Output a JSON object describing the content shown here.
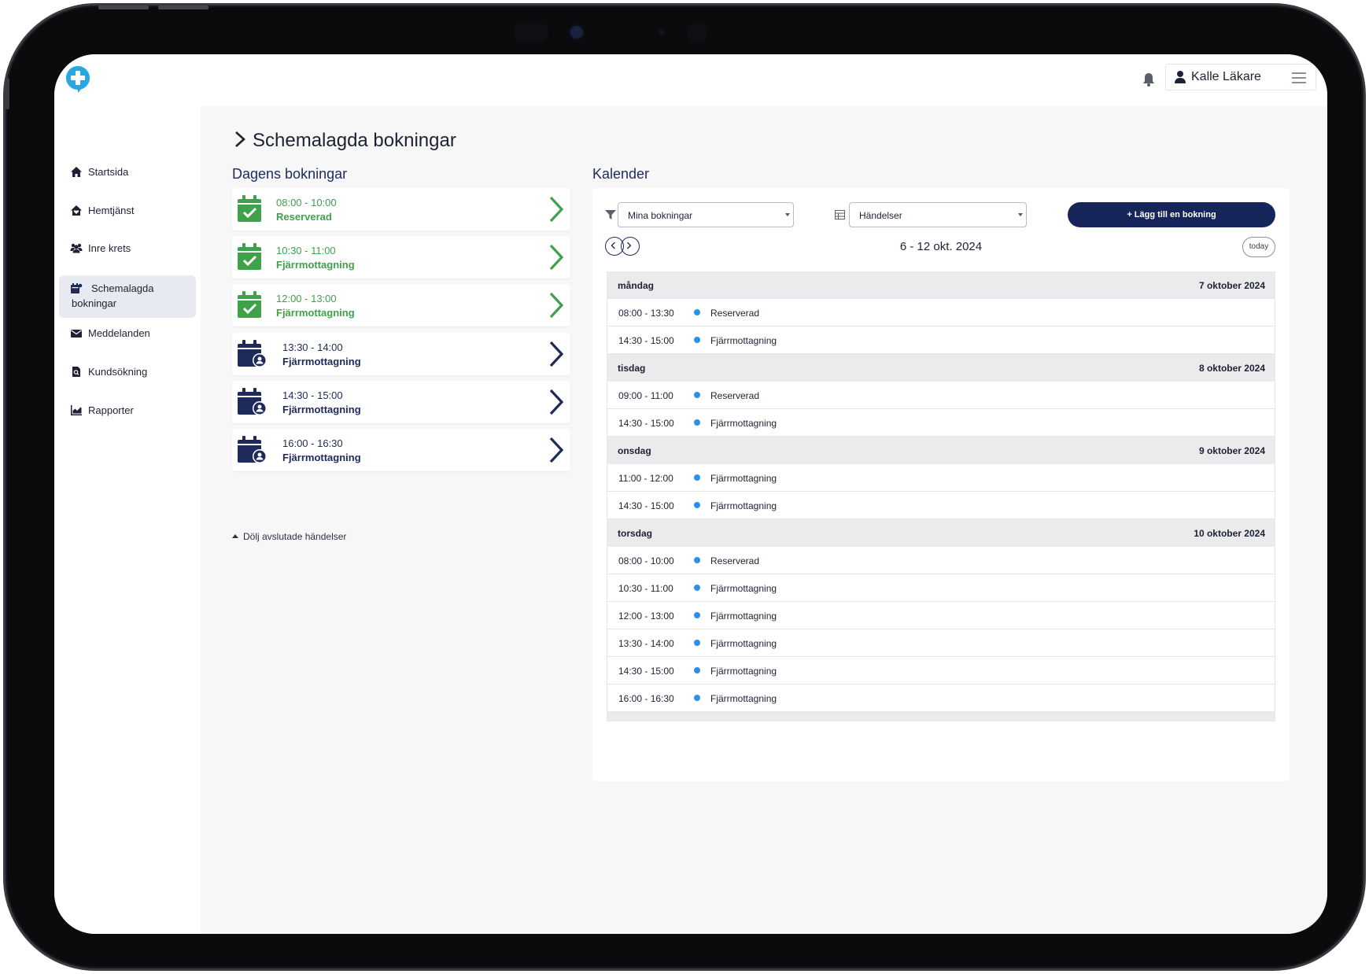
{
  "header": {
    "user_name": "Kalle Läkare"
  },
  "sidebar": {
    "items": [
      {
        "label": "Startsida",
        "icon": "home-icon"
      },
      {
        "label": "Hemtjänst",
        "icon": "house-heart-icon"
      },
      {
        "label": "Inre krets",
        "icon": "users-icon"
      },
      {
        "label": "Schemalagda",
        "label2": "bokningar",
        "icon": "calendar-user-icon",
        "active": true
      },
      {
        "label": "Meddelanden",
        "icon": "envelope-icon"
      },
      {
        "label": "Kundsökning",
        "icon": "file-search-icon"
      },
      {
        "label": "Rapporter",
        "icon": "chart-icon"
      }
    ]
  },
  "page": {
    "title": "Schemalagda bokningar",
    "today_title": "Dagens bokningar",
    "calendar_title": "Kalender",
    "hide_link": "Dölj avslutade händelser"
  },
  "bookings": [
    {
      "time": "08:00 - 10:00",
      "kind": "Reserverad",
      "status": "done"
    },
    {
      "time": "10:30 - 11:00",
      "kind": "Fjärrmottagning",
      "status": "done"
    },
    {
      "time": "12:00 - 13:00",
      "kind": "Fjärrmottagning",
      "status": "done"
    },
    {
      "time": "13:30 - 14:00",
      "kind": "Fjärrmottagning",
      "status": "upcoming"
    },
    {
      "time": "14:30 - 15:00",
      "kind": "Fjärrmottagning",
      "status": "upcoming"
    },
    {
      "time": "16:00 - 16:30",
      "kind": "Fjärrmottagning",
      "status": "upcoming"
    }
  ],
  "calendar": {
    "filter_value": "Mina bokningar",
    "view_value": "Händelser",
    "add_label": "+ Lägg till en bokning",
    "range": "6 - 12 okt. 2024",
    "today_label": "today",
    "days": [
      {
        "name": "måndag",
        "date": "7 oktober 2024",
        "events": [
          {
            "time": "08:00 - 13:30",
            "title": "Reserverad"
          },
          {
            "time": "14:30 - 15:00",
            "title": "Fjärrmottagning"
          }
        ]
      },
      {
        "name": "tisdag",
        "date": "8 oktober 2024",
        "events": [
          {
            "time": "09:00 - 11:00",
            "title": "Reserverad"
          },
          {
            "time": "14:30 - 15:00",
            "title": "Fjärrmottagning"
          }
        ]
      },
      {
        "name": "onsdag",
        "date": "9 oktober 2024",
        "events": [
          {
            "time": "11:00 - 12:00",
            "title": "Fjärrmottagning"
          },
          {
            "time": "14:30 - 15:00",
            "title": "Fjärrmottagning"
          }
        ]
      },
      {
        "name": "torsdag",
        "date": "10 oktober 2024",
        "events": [
          {
            "time": "08:00 - 10:00",
            "title": "Reserverad"
          },
          {
            "time": "10:30 - 11:00",
            "title": "Fjärrmottagning"
          },
          {
            "time": "12:00 - 13:00",
            "title": "Fjärrmottagning"
          },
          {
            "time": "13:30 - 14:00",
            "title": "Fjärrmottagning"
          },
          {
            "time": "14:30 - 15:00",
            "title": "Fjärrmottagning"
          },
          {
            "time": "16:00 - 16:30",
            "title": "Fjärrmottagning"
          }
        ]
      }
    ]
  },
  "colors": {
    "navy": "#17265a",
    "green": "#3fa14a",
    "event_dot": "#2c8fe8",
    "logo": "#2aa7e0"
  }
}
